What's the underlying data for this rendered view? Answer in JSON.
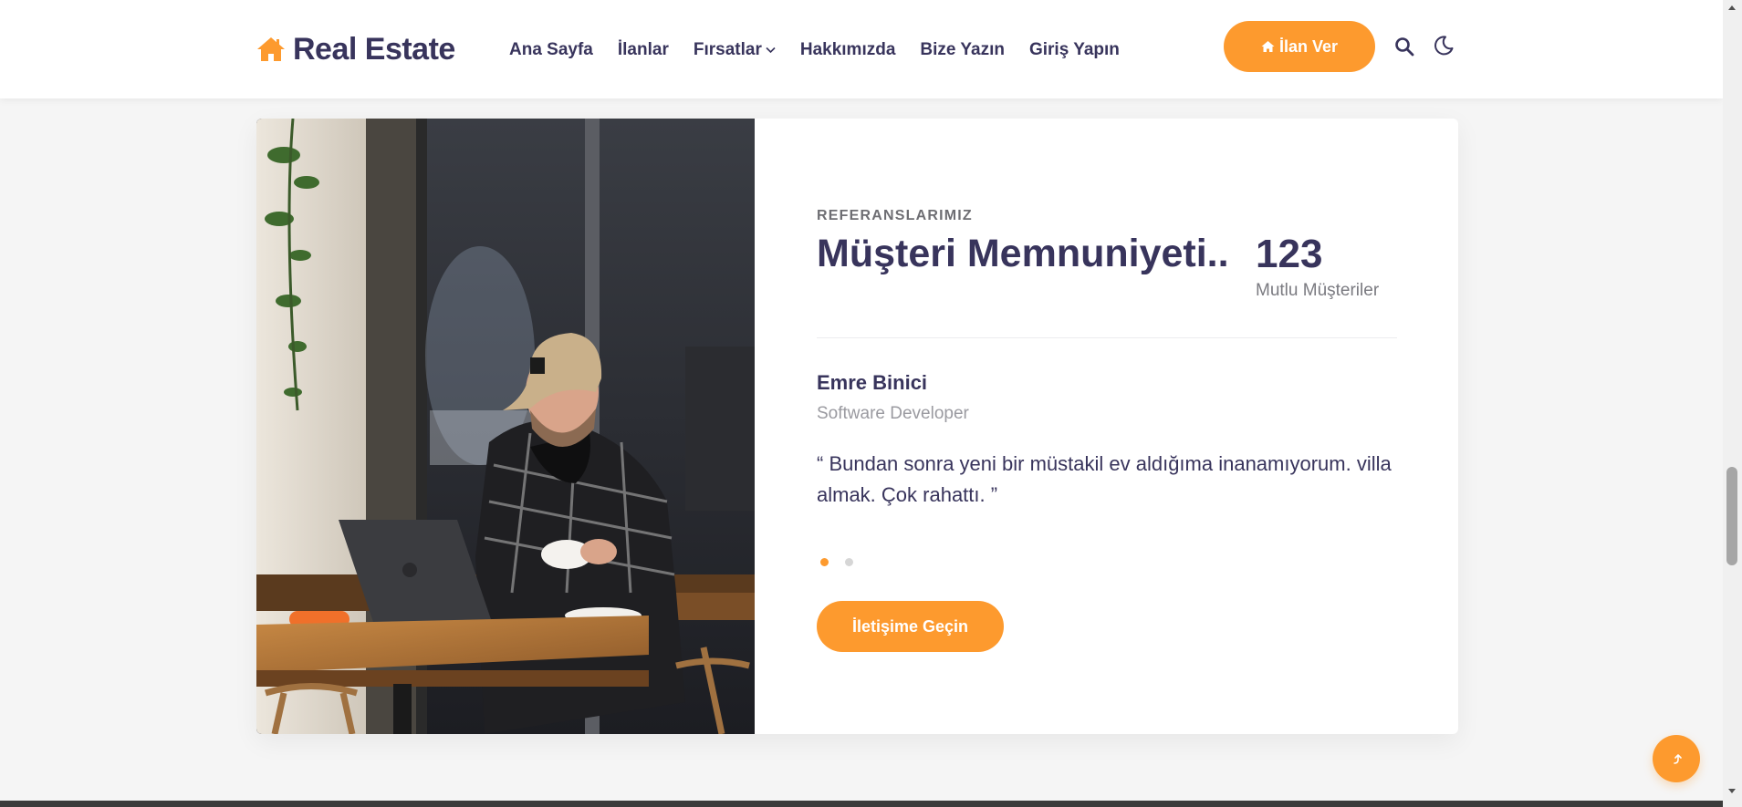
{
  "header": {
    "logo_text": "Real Estate",
    "logo_icon": "home-icon",
    "nav": [
      {
        "label": "Ana Sayfa"
      },
      {
        "label": "İlanlar"
      },
      {
        "label": "Fırsatlar",
        "has_dropdown": true
      },
      {
        "label": "Hakkımızda"
      },
      {
        "label": "Bize Yazın"
      },
      {
        "label": "Giriş Yapın"
      }
    ],
    "post_button_label": "İlan Ver",
    "search_icon": "search-icon",
    "theme_icon": "moon-icon"
  },
  "testimonial": {
    "eyebrow": "REFERANSLARIMIZ",
    "title": "Müşteri Memnuniyeti..",
    "stat_number": "123",
    "stat_label": "Mutlu Müşteriler",
    "person_name": "Emre Binici",
    "person_role": "Software Developer",
    "quote": "“ Bundan sonra yeni bir müstakil ev aldığıma inanamıyorum. villa almak. Çok rahattı. ”",
    "slides_total": 2,
    "active_slide": 1,
    "contact_button_label": "İletişime Geçin"
  },
  "colors": {
    "accent": "#fd9a2e",
    "heading": "#38345c",
    "background": "#f5f5f5"
  },
  "back_to_top_icon": "arrow-up-icon"
}
